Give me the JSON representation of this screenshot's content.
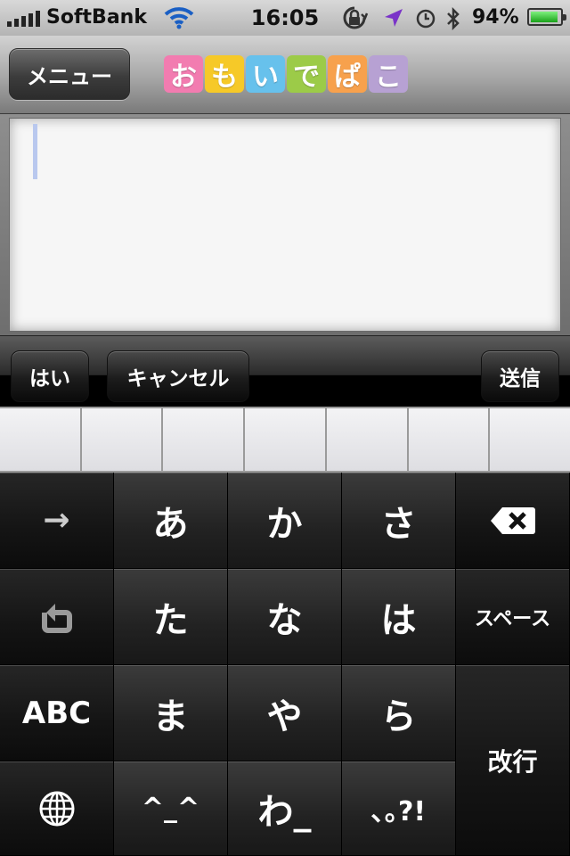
{
  "status_bar": {
    "carrier": "SoftBank",
    "time": "16:05",
    "battery": "94%",
    "battery_level": 0.94,
    "icons": [
      "signal-bars-icon",
      "wifi-icon",
      "rotation-lock-icon",
      "location-arrow-icon",
      "alarm-clock-icon",
      "bluetooth-icon",
      "battery-icon"
    ]
  },
  "nav": {
    "menu_label": "メニュー",
    "logo": [
      {
        "char": "お",
        "color": "#f27cb0"
      },
      {
        "char": "も",
        "color": "#f6c928"
      },
      {
        "char": "い",
        "color": "#67c1ec"
      },
      {
        "char": "で",
        "color": "#9ccb48"
      },
      {
        "char": "ぱ",
        "color": "#f7a14d"
      },
      {
        "char": "こ",
        "color": "#b7a1d3"
      }
    ]
  },
  "editor": {
    "value": ""
  },
  "toolbar": {
    "yes_label": "はい",
    "cancel_label": "キャンセル",
    "send_label": "送信"
  },
  "keyboard": {
    "keys": {
      "arrow": "→",
      "a": "あ",
      "ka": "か",
      "sa": "さ",
      "ta": "た",
      "na": "な",
      "ha": "は",
      "space": "スペース",
      "abc": "ABC",
      "ma": "ま",
      "ya": "や",
      "ra": "ら",
      "enter": "改行",
      "kaomoji": "^_^",
      "wa": "わ_",
      "punct": "､｡?!"
    }
  }
}
